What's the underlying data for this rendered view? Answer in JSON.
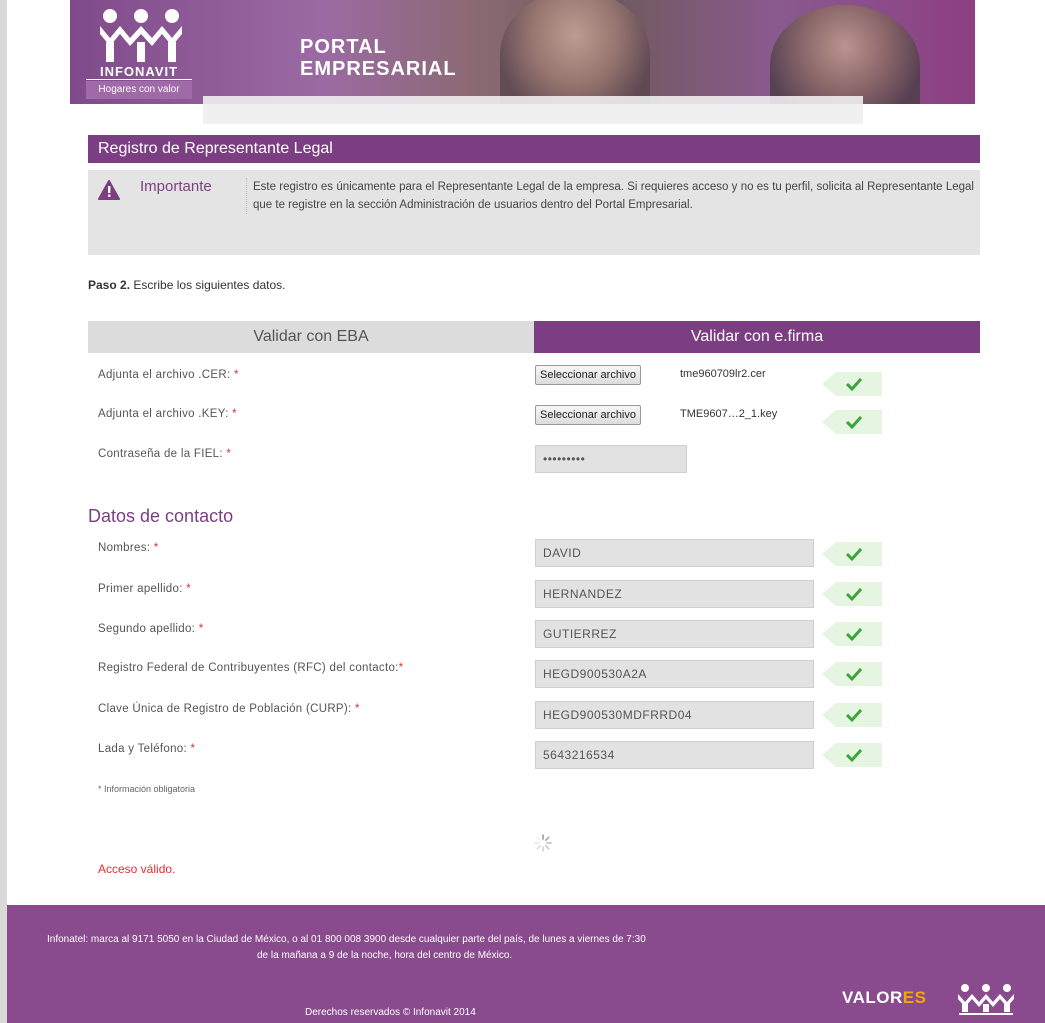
{
  "header": {
    "brand": "INFONAVIT",
    "tagline": "Hogares con valor",
    "portal_line1": "PORTAL",
    "portal_line2": "EMPRESARIAL"
  },
  "form": {
    "title": "Registro de Representante Legal",
    "important": {
      "label": "Importante",
      "text": "Este registro es únicamente para el Representante Legal de la empresa. Si requieres acceso y no es tu perfil, solicita al Representante Legal que te registre en la sección Administración de usuarios dentro del Portal Empresarial."
    },
    "step_label": "Paso 2.",
    "step_text": "Escribe los siguientes datos.",
    "tabs": [
      {
        "label": "Validar con EBA",
        "active": false
      },
      {
        "label": "Validar con e.firma",
        "active": true
      }
    ],
    "cer": {
      "label": "Adjunta el archivo .CER:",
      "button": "Seleccionar archivo",
      "filename": "tme960709lr2.cer"
    },
    "key": {
      "label": "Adjunta el archivo .KEY:",
      "button": "Seleccionar archivo",
      "filename": "TME9607…2_1.key"
    },
    "fiel": {
      "label": "Contraseña de la FIEL:",
      "value": "•••••••••"
    },
    "required_mark": "*"
  },
  "contact": {
    "title": "Datos de contacto",
    "fields": [
      {
        "label": "Nombres:",
        "value": "DAVID"
      },
      {
        "label": "Primer apellido:",
        "value": "HERNANDEZ"
      },
      {
        "label": "Segundo apellido:",
        "value": "GUTIERREZ"
      },
      {
        "label": "Registro Federal de Contribuyentes (RFC) del contacto:",
        "value": "HEGD900530A2A"
      },
      {
        "label": "Clave Única de Registro de Población (CURP):",
        "value": "HEGD900530MDFRRD04"
      },
      {
        "label": "Lada y Teléfono:",
        "value": "5643216534"
      }
    ],
    "mandatory_note": "* Información obligatoria",
    "status": "Acceso válido."
  },
  "footer": {
    "line1": "Infonatel: marca al 9171 5050 en la Ciudad de México, o al 01 800 008 3900 desde cualquier parte del país, de lunes a viernes de 7:30",
    "line2": "de la mañana a 9 de la noche, hora del centro de México.",
    "rights": "Derechos reservados © Infonavit 2014",
    "valores_a": "VALOR",
    "valores_b": "ES"
  },
  "colors": {
    "brand_purple": "#7c3e82",
    "footer_purple": "#8a4a8e",
    "ok_green": "#3aa53a",
    "error_red": "#e03030",
    "accent_orange": "#f2a900"
  }
}
